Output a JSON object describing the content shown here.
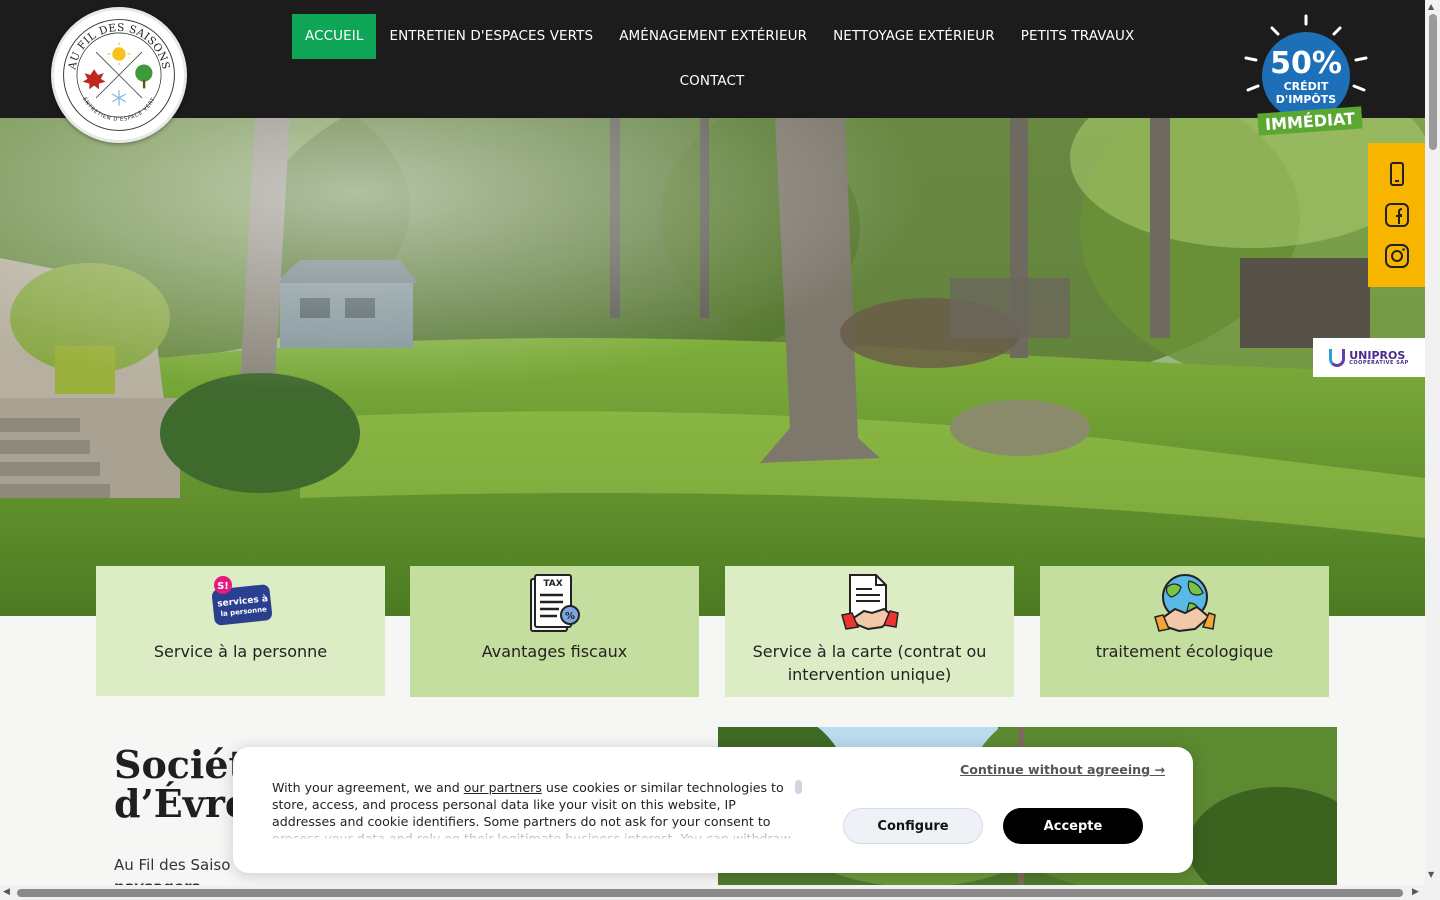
{
  "header": {
    "logo": {
      "name": "au-fil-des-saisons-logo",
      "text_top": "AU FIL DES SAISONS",
      "text_bottom": "ENTRETIEN D'ESPACE VERT"
    },
    "nav": [
      {
        "label": "ACCUEIL",
        "active": true
      },
      {
        "label": "ENTRETIEN D'ESPACES VERTS",
        "active": false
      },
      {
        "label": "AMÉNAGEMENT EXTÉRIEUR",
        "active": false
      },
      {
        "label": "NETTOYAGE EXTÉRIEUR",
        "active": false
      },
      {
        "label": "PETITS TRAVAUX",
        "active": false
      },
      {
        "label": "CONTACT",
        "active": false
      }
    ],
    "tax_badge": {
      "percent": "50%",
      "line1": "CRÉDIT",
      "line2": "D'IMPÔTS",
      "line3": "IMMÉDIAT"
    }
  },
  "side": {
    "icons": [
      "phone-icon",
      "facebook-icon",
      "instagram-icon"
    ],
    "partner_logo": {
      "name": "UNIPROS",
      "subtitle": "COOPERATIVE SAP"
    }
  },
  "features": [
    {
      "icon": "services-a-la-personne-icon",
      "label": "Service à la personne"
    },
    {
      "icon": "tax-document-icon",
      "label": "Avantages fiscaux"
    },
    {
      "icon": "contract-handshake-icon",
      "label": "Service à la carte (contrat ou intervention unique)"
    },
    {
      "icon": "eco-globe-handshake-icon",
      "label": "traitement écologique"
    }
  ],
  "main": {
    "heading_line1": "Sociét",
    "heading_line2": "d’Évre",
    "intro_start": "Au Fil des Saiso",
    "intro_bold": "paysagers"
  },
  "cookie": {
    "text_before_link": "With your agreement, we and ",
    "link": "our partners",
    "text_after_link": " use cookies or similar technologies to store, access, and process personal data like your visit on this website, IP addresses and cookie identifiers. Some partners do not ask for your consent to process your data and rely on their legitimate business interest. You can withdraw your consent or object to data processing based on legitimate interest at any time by clicking on \"Learn More\" or in our Privacy Policy on this website.",
    "continue_label": "Continue without agreeing →",
    "configure_label": "Configure",
    "accept_label": "Accepte"
  },
  "colors": {
    "header_bg": "#1c1c1c",
    "nav_active": "#0ea556",
    "social_bar": "#f7b500",
    "feature_light": "#dcecc5",
    "feature_dark": "#c4dea0"
  }
}
